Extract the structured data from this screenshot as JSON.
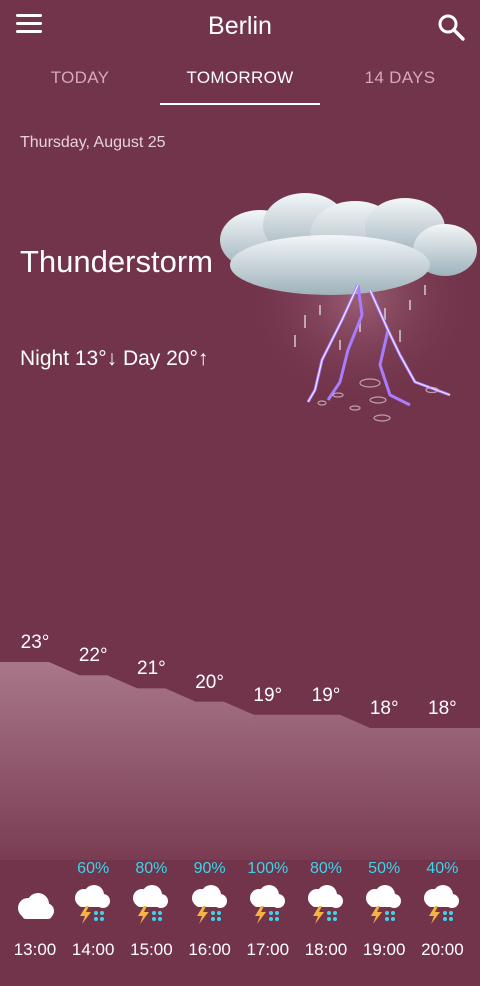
{
  "header": {
    "city": "Berlin"
  },
  "tabs": [
    {
      "label": "TODAY",
      "active": false
    },
    {
      "label": "TOMORROW",
      "active": true
    },
    {
      "label": "14 DAYS",
      "active": false
    }
  ],
  "summary": {
    "date": "Thursday, August 25",
    "condition": "Thunderstorm",
    "minmax": "Night 13°↓ Day 20°↑",
    "icon": "thunderstorm-icon"
  },
  "hourly": [
    {
      "time": "13:00",
      "temp": "23°",
      "pop": "",
      "icon": "cloud-icon"
    },
    {
      "time": "14:00",
      "temp": "22°",
      "pop": "60%",
      "icon": "thunder-rain-icon"
    },
    {
      "time": "15:00",
      "temp": "21°",
      "pop": "80%",
      "icon": "thunder-rain-icon"
    },
    {
      "time": "16:00",
      "temp": "20°",
      "pop": "90%",
      "icon": "thunder-rain-icon"
    },
    {
      "time": "17:00",
      "temp": "19°",
      "pop": "100%",
      "icon": "thunder-rain-icon"
    },
    {
      "time": "18:00",
      "temp": "19°",
      "pop": "80%",
      "icon": "thunder-rain-icon"
    },
    {
      "time": "19:00",
      "temp": "18°",
      "pop": "50%",
      "icon": "thunder-rain-icon"
    },
    {
      "time": "20:00",
      "temp": "18°",
      "pop": "40%",
      "icon": "thunder-rain-icon"
    }
  ],
  "colors": {
    "background": "#72344a",
    "precip": "#3fd3ea",
    "chart_fill": "#9a6a7c"
  }
}
